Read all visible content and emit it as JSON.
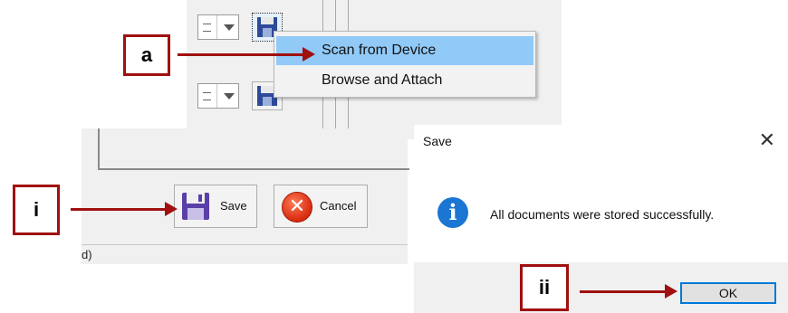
{
  "context_menu": {
    "items": [
      {
        "label": "Scan from Device",
        "highlighted": true
      },
      {
        "label": "Browse and Attach",
        "highlighted": false
      }
    ]
  },
  "form": {
    "save_label": "Save",
    "cancel_label": "Cancel",
    "status_fragment": "d)"
  },
  "dialog": {
    "title": "Save",
    "close_glyph": "✕",
    "info_glyph": "i",
    "message": "All documents were stored successfully.",
    "ok_label": "OK"
  },
  "callouts": {
    "a": "a",
    "i": "i",
    "ii": "ii"
  },
  "colors": {
    "callout_red": "#a01010",
    "menu_highlight": "#91c9f7",
    "dialog_accent": "#0078d7",
    "info_blue": "#1a76d2"
  }
}
